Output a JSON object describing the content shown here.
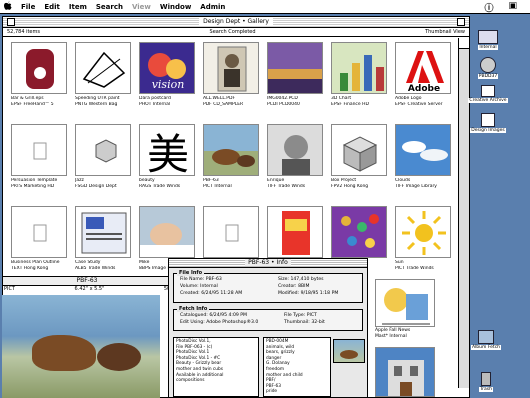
{
  "menubar": {
    "apple": "",
    "items": [
      "File",
      "Edit",
      "Item",
      "Search",
      "View",
      "Window",
      "Admin"
    ],
    "disabled": [
      "View"
    ],
    "right_icons": [
      "help-icon",
      "app-switcher-icon"
    ]
  },
  "window": {
    "title": "Design Dept • Gallery",
    "item_count": "52,784 items",
    "status": "Search Completed",
    "view_mode": "Thumbnail View"
  },
  "thumbnails": [
    {
      "name": "Bar & Grill.eps",
      "type": "EPSF",
      "source": "FreeHand™ 5",
      "row": 0,
      "col": 0,
      "style": "guitar"
    },
    {
      "name": "Speeding UTR paint",
      "type": "PNTG",
      "source": "Western Bag",
      "row": 0,
      "col": 1,
      "style": "sketch"
    },
    {
      "name": "Dara postcard",
      "type": "PHOT",
      "source": "Internal",
      "row": 0,
      "col": 2,
      "style": "vision",
      "art_text": "vision"
    },
    {
      "name": "ALL.WELL.PDF",
      "type": "PDF",
      "source": "CD_SAMPLER",
      "row": 0,
      "col": 3,
      "style": "portrait"
    },
    {
      "name": "IMG0042.PCD",
      "type": "PCDI",
      "source": "PCD0040",
      "row": 0,
      "col": 4,
      "style": "sunset"
    },
    {
      "name": "3D Chart",
      "type": "EPSF",
      "source": "Finance HD",
      "row": 0,
      "col": 5,
      "style": "chart"
    },
    {
      "name": "Adobe Logo",
      "type": "EPSF",
      "source": "Creative Server",
      "row": 0,
      "col": 6,
      "style": "adobe",
      "art_text": "Adobe"
    },
    {
      "name": "Persuasion Template",
      "type": "PRTS",
      "source": "Marketing HD",
      "row": 1,
      "col": 0,
      "style": "blank"
    },
    {
      "name": "Jazz",
      "type": "FSGD",
      "source": "Design Dept",
      "row": 1,
      "col": 1,
      "style": "cube"
    },
    {
      "name": "beauty",
      "type": "RAGS",
      "source": "Trade Winds",
      "row": 1,
      "col": 2,
      "style": "kanji",
      "art_text": "美"
    },
    {
      "name": "PBF-63",
      "type": "PICT",
      "source": "Internal",
      "row": 1,
      "col": 3,
      "style": "bears"
    },
    {
      "name": "Enrique",
      "type": "TIFF",
      "source": "Trade Winds",
      "row": 1,
      "col": 4,
      "style": "face"
    },
    {
      "name": "Box Project",
      "type": "FPV2",
      "source": "Hong Kong",
      "row": 1,
      "col": 5,
      "style": "box"
    },
    {
      "name": "Clouds",
      "type": "TIFF",
      "source": "Image Library",
      "row": 1,
      "col": 6,
      "style": "clouds"
    },
    {
      "name": "Business Plan Outline",
      "type": "TEXT",
      "source": "Hong Kong",
      "row": 2,
      "col": 0,
      "style": "blank"
    },
    {
      "name": "Case Study",
      "type": "ALB5",
      "source": "Trade Winds",
      "row": 2,
      "col": 1,
      "style": "doc"
    },
    {
      "name": "Mike",
      "type": "8BPS",
      "source": "Image Library",
      "row": 2,
      "col": 2,
      "style": "baby"
    },
    {
      "name": "Adobe Illustrator™ 5.5",
      "type": "",
      "source": "",
      "row": 2,
      "col": 3,
      "style": "blank"
    },
    {
      "name": "Murrell",
      "type": "",
      "source": "",
      "row": 2,
      "col": 4,
      "style": "cereal"
    },
    {
      "name": "CANDY_02.TIF",
      "type": "",
      "source": "",
      "row": 2,
      "col": 5,
      "style": "candy"
    },
    {
      "name": "Sun",
      "type": "PICT",
      "source": "Trade Winds",
      "row": 2,
      "col": 6,
      "style": "sun"
    }
  ],
  "preview": {
    "header": "PBF-63",
    "type": "PICT",
    "dims": "6.42\" x 5.5\"",
    "depth": "50%"
  },
  "info_panel": {
    "title": "PBF-63 • Info",
    "file_info_label": "File Info",
    "file_name_label": "File Name:",
    "file_name": "PBF-63",
    "volume_label": "Volume:",
    "volume": "Internal",
    "created_label": "Created:",
    "created": "6/24/95 11:28 AM",
    "size_label": "Size:",
    "size": "147,410 bytes",
    "creator_label": "Creator:",
    "creator": "8BIM",
    "modified_label": "Modified:",
    "modified": "9/18/95 1:18 PM",
    "fetch_info_label": "Fetch Info",
    "catalogued_label": "Catalogued:",
    "catalogued": "6/24/95 4:09 PM",
    "edit_label": "Edit Using:",
    "edit": "Adobe Photoshop®3.0",
    "filetype_label": "File Type:",
    "filetype": "PICT",
    "thumbnail_label": "Thumbnail:",
    "thumbnail": "32-bit",
    "description": "PhotoDisc Vol.1,\nFile PBF-063 - (c)\nPhotoDisc Vol.1\nPhotoDisc Vol.1 - #C\nBeauty - Grizzly bear\nmother and twin cubs\nAvailable in additional\ncompositions",
    "keywords": "PBD-004M\nanimals, wild\nbears, grizzly\ndanger\nG. Dolanay\nfreedom\nmother and child\nPBF/\nPBF-63\npride"
  },
  "right_tiles": [
    {
      "name": "Apple Fall News",
      "source": "Mast* Internal",
      "style": "cartoon"
    }
  ],
  "desktop_icons": [
    {
      "label": "Internal",
      "icon": "hard-drive-icon"
    },
    {
      "label": "PBDD37",
      "icon": "cd-icon"
    },
    {
      "label": "Creative Archive",
      "icon": "network-icon"
    },
    {
      "label": "Design Images",
      "icon": "server-icon"
    },
    {
      "label": "Album Fetch",
      "icon": "folder-icon"
    },
    {
      "label": "Trash",
      "icon": "trash-icon"
    }
  ]
}
